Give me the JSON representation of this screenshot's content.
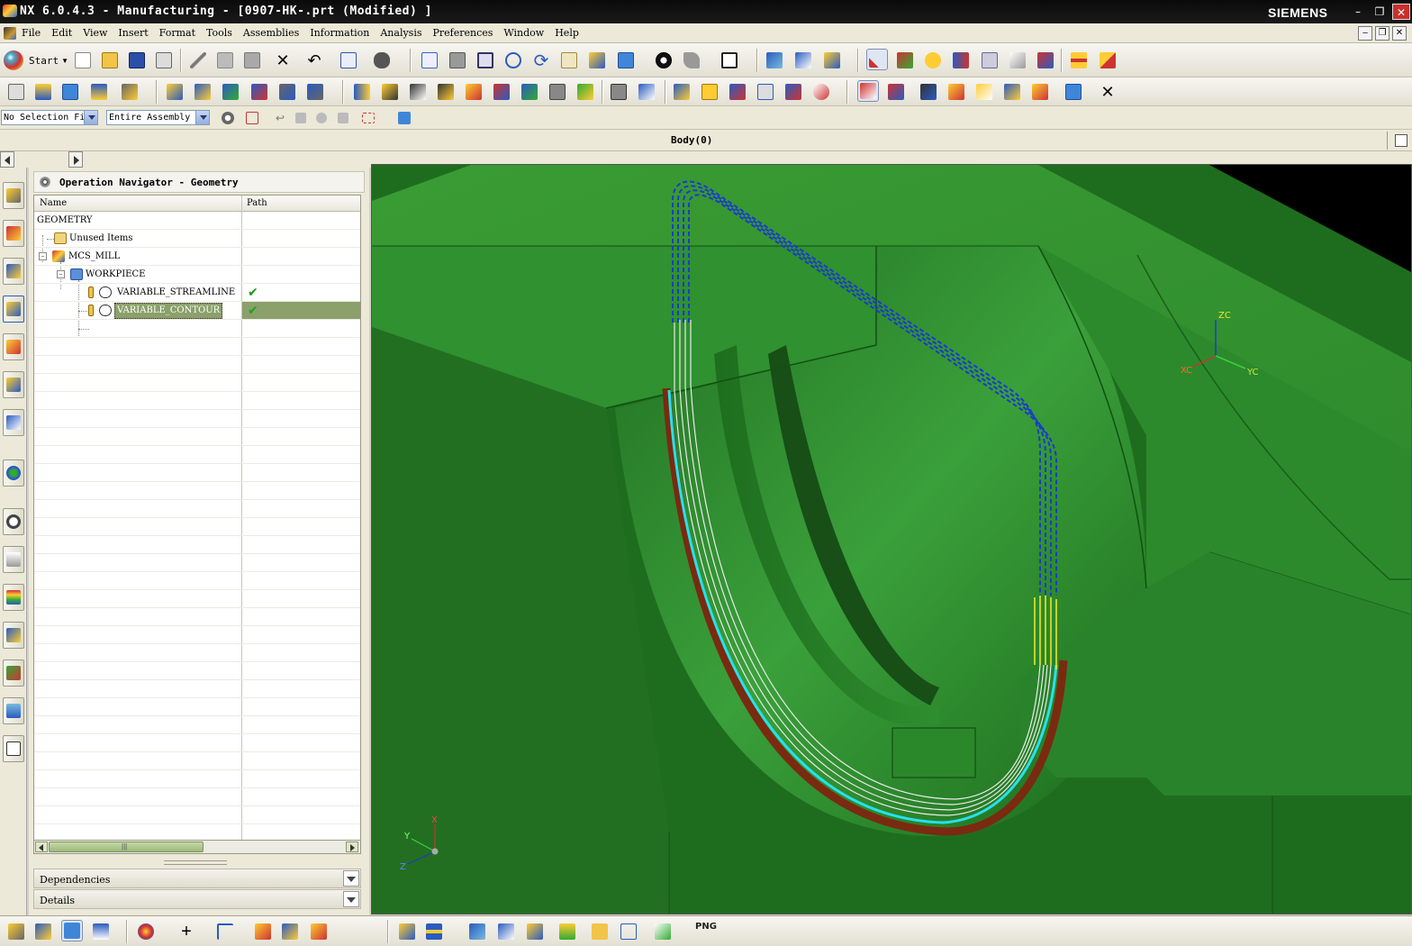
{
  "window": {
    "title": "NX 6.0.4.3 - Manufacturing - [0907-HK-.prt (Modified) ]",
    "brand": "SIEMENS",
    "controls": [
      "–",
      "❐",
      "✕"
    ]
  },
  "menubar": {
    "items": [
      "File",
      "Edit",
      "View",
      "Insert",
      "Format",
      "Tools",
      "Assemblies",
      "Information",
      "Analysis",
      "Preferences",
      "Window",
      "Help"
    ]
  },
  "toolbar": {
    "start_label": "Start",
    "selection_filter": "No Selection Fi",
    "scope": "Entire Assembly"
  },
  "cue_line": {
    "status": "Body(0)"
  },
  "navigator": {
    "title": "Operation Navigator - Geometry",
    "columns": [
      "Name",
      "Path"
    ],
    "rows": [
      {
        "label": "GEOMETRY",
        "path_ok": false
      },
      {
        "label": "Unused Items",
        "path_ok": false
      },
      {
        "label": "MCS_MILL",
        "path_ok": false
      },
      {
        "label": "WORKPIECE",
        "path_ok": false
      },
      {
        "label": "VARIABLE_STREAMLINE",
        "path_ok": true
      },
      {
        "label": "VARIABLE_CONTOUR",
        "path_ok": true,
        "selected": true
      }
    ],
    "sections": [
      "Dependencies",
      "Details"
    ]
  },
  "viewport": {
    "wcs_labels": [
      "ZC",
      "XC",
      "YC"
    ],
    "triad_labels": [
      "X",
      "Y",
      "Z"
    ]
  },
  "bottom_toolbar": {
    "png_label": "PNG"
  },
  "colors": {
    "part_green": "#2e8b2e",
    "toolpath_blue": "#1a3cc8",
    "toolpath_cyan": "#28e0f0",
    "toolpath_yellow": "#e8e820",
    "toolpath_brown": "#7a2a10",
    "selection_green": "#8ba06a"
  }
}
